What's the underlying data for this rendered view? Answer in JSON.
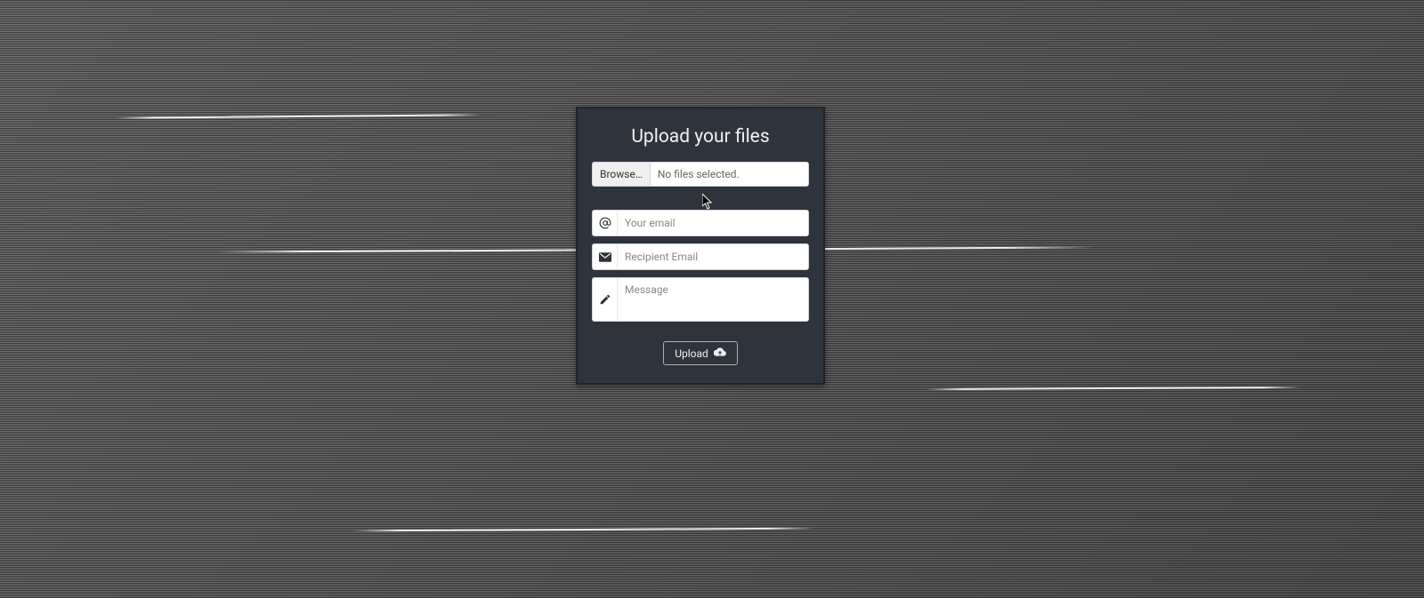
{
  "card": {
    "title": "Upload your files",
    "file": {
      "browse_label": "Browse…",
      "status": "No files selected."
    },
    "your_email": {
      "placeholder": "Your email",
      "value": ""
    },
    "recipient_email": {
      "placeholder": "Recipient Email",
      "value": ""
    },
    "message": {
      "placeholder": "Message",
      "value": ""
    },
    "upload_label": "Upload"
  },
  "colors": {
    "card_bg": "#2f343c",
    "card_border": "#1f242a",
    "field_bg": "#ffffff",
    "field_border": "#cfd4d9"
  }
}
